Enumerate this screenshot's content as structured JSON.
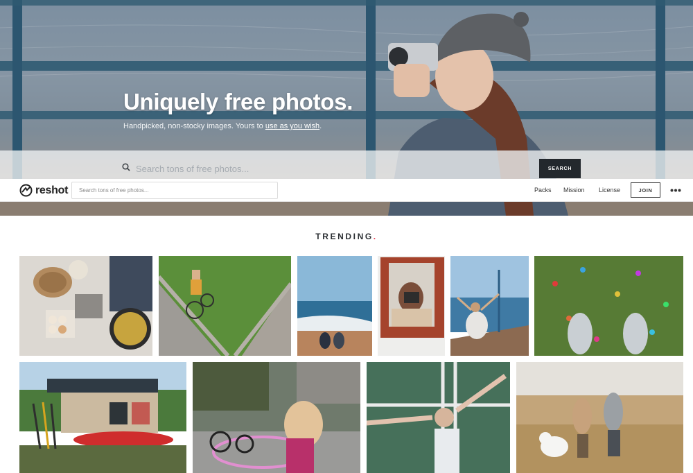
{
  "hero": {
    "title": "Uniquely free photos.",
    "subtitle_prefix": "Handpicked, non-stocky images. Yours to ",
    "subtitle_link": "use as you wish",
    "subtitle_suffix": ".",
    "search_placeholder": "Search tons of free photos...",
    "search_button": "SEARCH"
  },
  "navbar": {
    "logo_text": "reshot",
    "search_placeholder": "Search tons of free photos...",
    "links": [
      "Packs",
      "Mission",
      "License"
    ],
    "join_label": "JOIN",
    "more_icon": "more-dots-icon"
  },
  "trending": {
    "heading": "TRENDING",
    "accent_dot": ".",
    "accent_color": "#e8384f"
  },
  "photos": [
    {
      "subject": "bread-eggs-skillet"
    },
    {
      "subject": "child-bike-grass"
    },
    {
      "subject": "beach-couple"
    },
    {
      "subject": "mirror-camera"
    },
    {
      "subject": "woman-boat-sea"
    },
    {
      "subject": "feet-confetti-grass"
    },
    {
      "subject": "kayak-shop"
    },
    {
      "subject": "hula-hoop-street"
    },
    {
      "subject": "woman-lying-court"
    },
    {
      "subject": "couple-dog-field"
    }
  ]
}
